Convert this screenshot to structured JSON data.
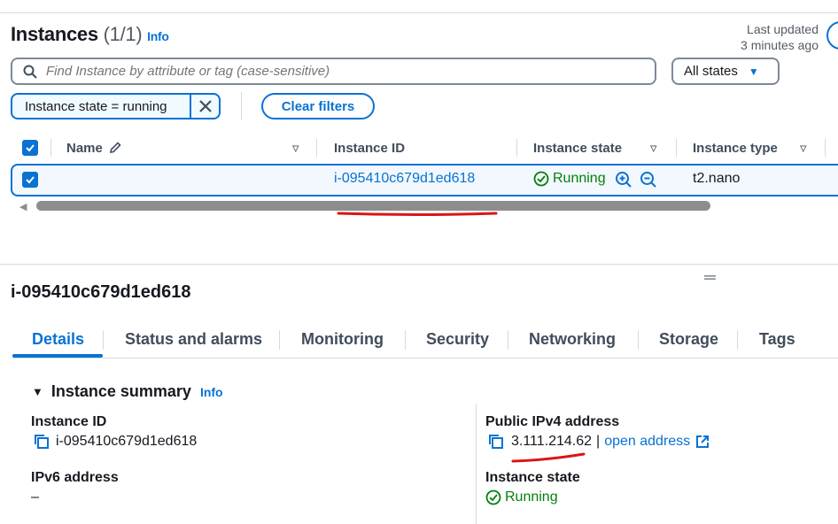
{
  "instances": {
    "title": "Instances",
    "count": "(1/1)",
    "info": "Info",
    "last_updated_line1": "Last updated",
    "last_updated_line2": "3 minutes ago",
    "search_placeholder": "Find Instance by attribute or tag (case-sensitive)",
    "states_select": "All states",
    "filter_token": "Instance state = running",
    "clear_filters": "Clear filters"
  },
  "table": {
    "columns": [
      "Name",
      "Instance ID",
      "Instance state",
      "Instance type"
    ],
    "rows": [
      {
        "name": "",
        "instance_id": "i-095410c679d1ed618",
        "state": "Running",
        "type": "t2.nano"
      }
    ]
  },
  "detail": {
    "title": "i-095410c679d1ed618",
    "tabs": [
      "Details",
      "Status and alarms",
      "Monitoring",
      "Security",
      "Networking",
      "Storage",
      "Tags"
    ],
    "section": "Instance summary",
    "section_info": "Info",
    "fields": {
      "instance_id_label": "Instance ID",
      "instance_id_value": "i-095410c679d1ed618",
      "ipv6_label": "IPv6 address",
      "ipv6_value": "–",
      "public_ipv4_label": "Public IPv4 address",
      "public_ipv4_value": "3.111.214.62",
      "separator": "|",
      "open_address": "open address",
      "state_label": "Instance state",
      "state_value": "Running"
    }
  },
  "colors": {
    "accent": "#0972d3",
    "success": "#037f0c",
    "annotation": "#d91515"
  }
}
